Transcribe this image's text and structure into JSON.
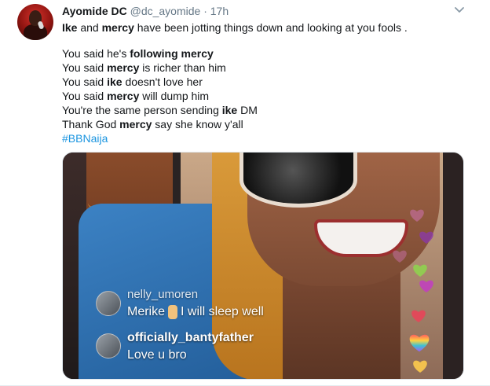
{
  "tweet": {
    "author_name": "Ayomide DC",
    "handle": "@dc_ayomide",
    "separator": "·",
    "time": "17h",
    "lines": [
      {
        "pre": "",
        "bold": "Ike",
        "post": " and ",
        "bold2": "mercy",
        "post2": " have been jotting things down and looking at you fools ."
      },
      {
        "pre": "You said he's ",
        "bold": "following mercy",
        "post": ""
      },
      {
        "pre": "You said ",
        "bold": "mercy",
        "post": " is richer than him"
      },
      {
        "pre": "You said ",
        "bold": "ike",
        "post": " doesn't love her"
      },
      {
        "pre": "You said ",
        "bold": "mercy",
        "post": " will dump him"
      },
      {
        "pre": "You're the same person sending ",
        "bold": "ike",
        "post": " DM"
      },
      {
        "pre": "Thank God ",
        "bold": "mercy",
        "post": " say she know y'all"
      }
    ],
    "hashtag": "#BBNaija"
  },
  "media": {
    "comments": [
      {
        "user": "nelly_umoren",
        "message_pre": "Merike",
        "message_post": "I will sleep well"
      },
      {
        "user": "officially_bantyfather",
        "message": "Love u bro"
      }
    ]
  },
  "icons": {
    "caret": "chevron-down-icon"
  },
  "colors": {
    "link": "#1b95e0",
    "secondary_text": "#657786"
  }
}
